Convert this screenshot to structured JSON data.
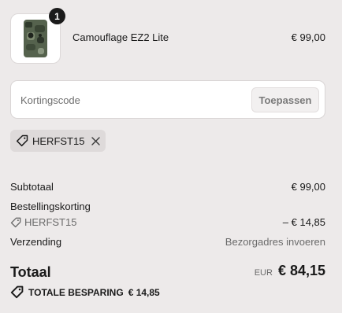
{
  "product": {
    "quantity": "1",
    "name": "Camouflage EZ2 Lite",
    "price": "€ 99,00",
    "thumbnail_icon": "trail-camera-icon"
  },
  "discount": {
    "placeholder": "Kortingscode",
    "apply_label": "Toepassen"
  },
  "applied_code": {
    "code": "HERFST15",
    "tag_icon": "tag-icon",
    "remove_icon": "close-icon"
  },
  "summary": {
    "subtotal_label": "Subtotaal",
    "subtotal_value": "€ 99,00",
    "order_discount_label": "Bestellingskorting",
    "order_discount_code": "HERFST15",
    "order_discount_value": "– € 14,85",
    "shipping_label": "Verzending",
    "shipping_value": "Bezorgadres invoeren",
    "total_label": "Totaal",
    "total_currency": "EUR",
    "total_value": "€ 84,15",
    "savings_label": "TOTALE BESPARING",
    "savings_value": "€ 14,85"
  },
  "colors": {
    "background": "#edeaea",
    "text": "#1a1a1a",
    "muted": "#6b6b6b",
    "badge": "#1b1b1b"
  }
}
